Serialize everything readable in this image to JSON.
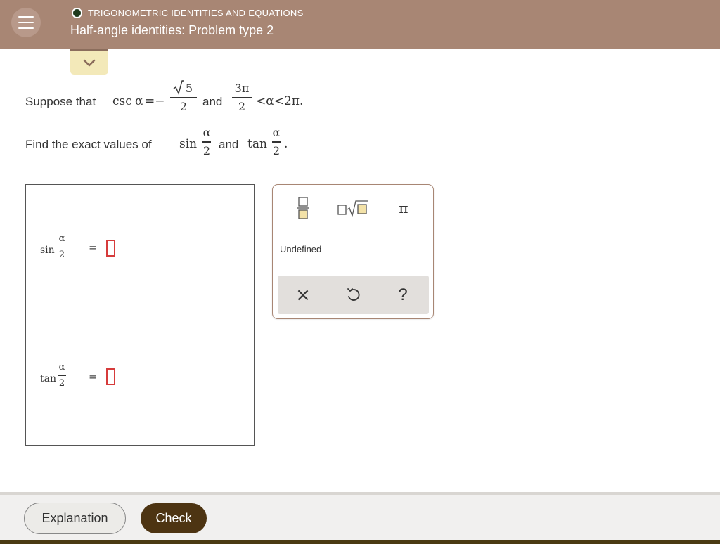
{
  "header": {
    "topic": "TRIGONOMETRIC IDENTITIES AND EQUATIONS",
    "title": "Half-angle identities: Problem type 2"
  },
  "problem": {
    "suppose_text": "Suppose that",
    "csc": "csc",
    "alpha": "α",
    "equals_neg": "=−",
    "sqrt5": "5",
    "two": "2",
    "and_text": "and",
    "three_pi": "3π",
    "ineq": "<α<2π.",
    "find_text": "Find the exact values of",
    "sin": "sin",
    "and_text2": "and",
    "tan": "tan",
    "period": "."
  },
  "answers": [
    {
      "func": "sin",
      "num": "α",
      "den": "2",
      "eq": "="
    },
    {
      "func": "tan",
      "num": "α",
      "den": "2",
      "eq": "="
    }
  ],
  "keypad": {
    "fraction_icon": "fraction-icon",
    "sqrt_icon": "sqrt-icon",
    "pi_label": "π",
    "undefined_label": "Undefined",
    "clear_label": "×",
    "undo_icon": "undo-icon",
    "help_label": "?"
  },
  "footer": {
    "explanation_label": "Explanation",
    "check_label": "Check"
  },
  "colors": {
    "header": "#a88674",
    "input_border": "#d63b3b",
    "check_button": "#4d3412",
    "collapse_button": "#f3e9b9"
  }
}
